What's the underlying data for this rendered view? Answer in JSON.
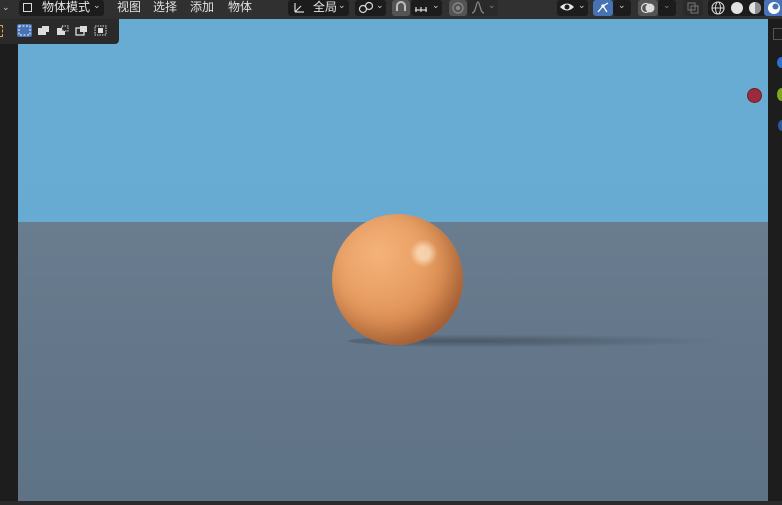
{
  "header": {
    "mode_label": "物体模式",
    "menus": [
      {
        "key": "view",
        "label": "视图"
      },
      {
        "key": "select",
        "label": "选择"
      },
      {
        "key": "add",
        "label": "添加"
      },
      {
        "key": "object",
        "label": "物体"
      }
    ],
    "transform_orientation": "全局",
    "icons": {
      "editor_type": "view3d-editor-icon",
      "mode": "object-mode-icon",
      "orientation": "transform-orientation-icon",
      "pivot": "pivot-point-icon",
      "snap": "snap-magnet-icon",
      "snap_target": "snap-increment-icon",
      "proportional": "proportional-editing-icon",
      "falloff": "falloff-curve-icon",
      "visibility": "object-visibility-icon",
      "gizmo": "gizmo-toggle-icon",
      "overlays": "overlays-icon",
      "xray": "xray-icon",
      "shading": [
        "wireframe-shading-icon",
        "solid-shading-icon",
        "material-preview-icon",
        "rendered-shading-icon"
      ]
    }
  },
  "toolbar": {
    "selection_modes": [
      "select-new-icon",
      "select-extend-icon",
      "select-subtract-icon",
      "select-invert-icon",
      "select-intersect-icon"
    ],
    "active_index": 0
  },
  "viewport": {
    "scene": "orange-sphere-on-ground",
    "colors": {
      "sky": "#67abd3",
      "ground": "#667a8d",
      "orange": "#e59c61"
    }
  },
  "navigation_gizmo": {
    "x_axis_color": "#9b2b3c",
    "y_axis_color": "#7fa81c",
    "z_axis_color": "#2a72d1"
  }
}
